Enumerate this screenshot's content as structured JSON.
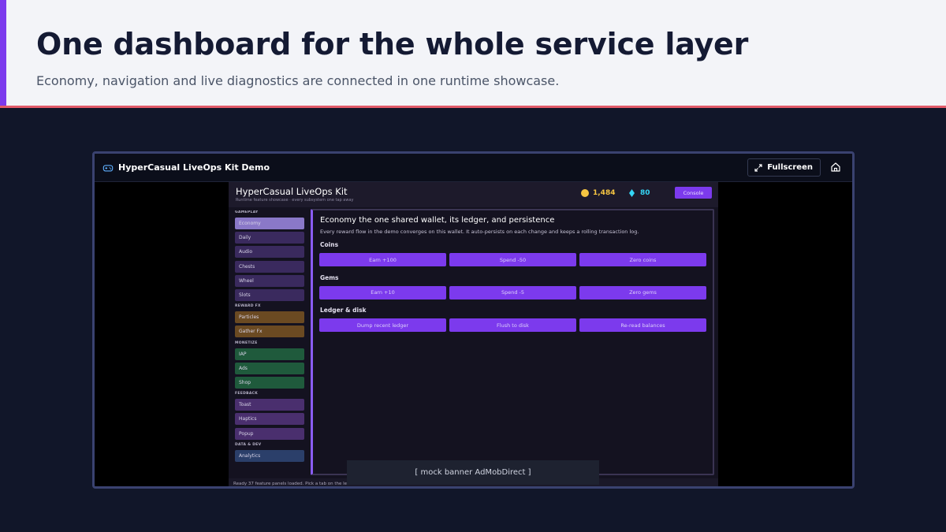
{
  "slide": {
    "title": "One dashboard for the whole service layer",
    "subtitle": "Economy, navigation and live diagnostics are connected in one runtime showcase.",
    "accent_color": "#7c3aed",
    "underline_color": "#e25b6a"
  },
  "window": {
    "title": "HyperCasual LiveOps Kit Demo",
    "title_icon": "gamepad-icon",
    "fullscreen_label": "Fullscreen",
    "fullscreen_icon": "expand-icon",
    "home_icon": "home-icon"
  },
  "game": {
    "title": "HyperCasual LiveOps Kit",
    "subtitle": "Runtime feature showcase · every subsystem one tap away",
    "coins": "1,484",
    "gems": "80",
    "console_label": "Console",
    "sidebar": {
      "sections": [
        {
          "label": "GAMEPLAY",
          "items": [
            "Economy",
            "Daily",
            "Audio",
            "Chests",
            "Wheel",
            "Slots"
          ]
        },
        {
          "label": "REWARD FX",
          "items": [
            "Particles",
            "Gather Fx"
          ]
        },
        {
          "label": "MONETIZE",
          "items": [
            "IAP",
            "Ads",
            "Shop"
          ]
        },
        {
          "label": "FEEDBACK",
          "items": [
            "Toast",
            "Haptics",
            "Popup"
          ]
        },
        {
          "label": "DATA & DEV",
          "items": [
            "Analytics"
          ]
        }
      ],
      "active_item": "Economy"
    },
    "panel": {
      "heading": "Economy  the one shared wallet, its ledger, and persistence",
      "description": "Every reward flow in the demo converges on this wallet. It auto-persists on each change and keeps a rolling transaction log.",
      "groups": [
        {
          "label": "Coins",
          "buttons": [
            "Earn +100",
            "Spend -50",
            "Zero coins"
          ]
        },
        {
          "label": "Gems",
          "buttons": [
            "Earn +10",
            "Spend -5",
            "Zero gems"
          ]
        },
        {
          "label": "Ledger & disk",
          "buttons": [
            "Dump recent ledger",
            "Flush to disk",
            "Re-read balances"
          ]
        }
      ]
    },
    "status": "Ready  37 feature panels loaded. Pick a tab on the le",
    "banner": "[ mock banner   AdMobDirect ]"
  }
}
